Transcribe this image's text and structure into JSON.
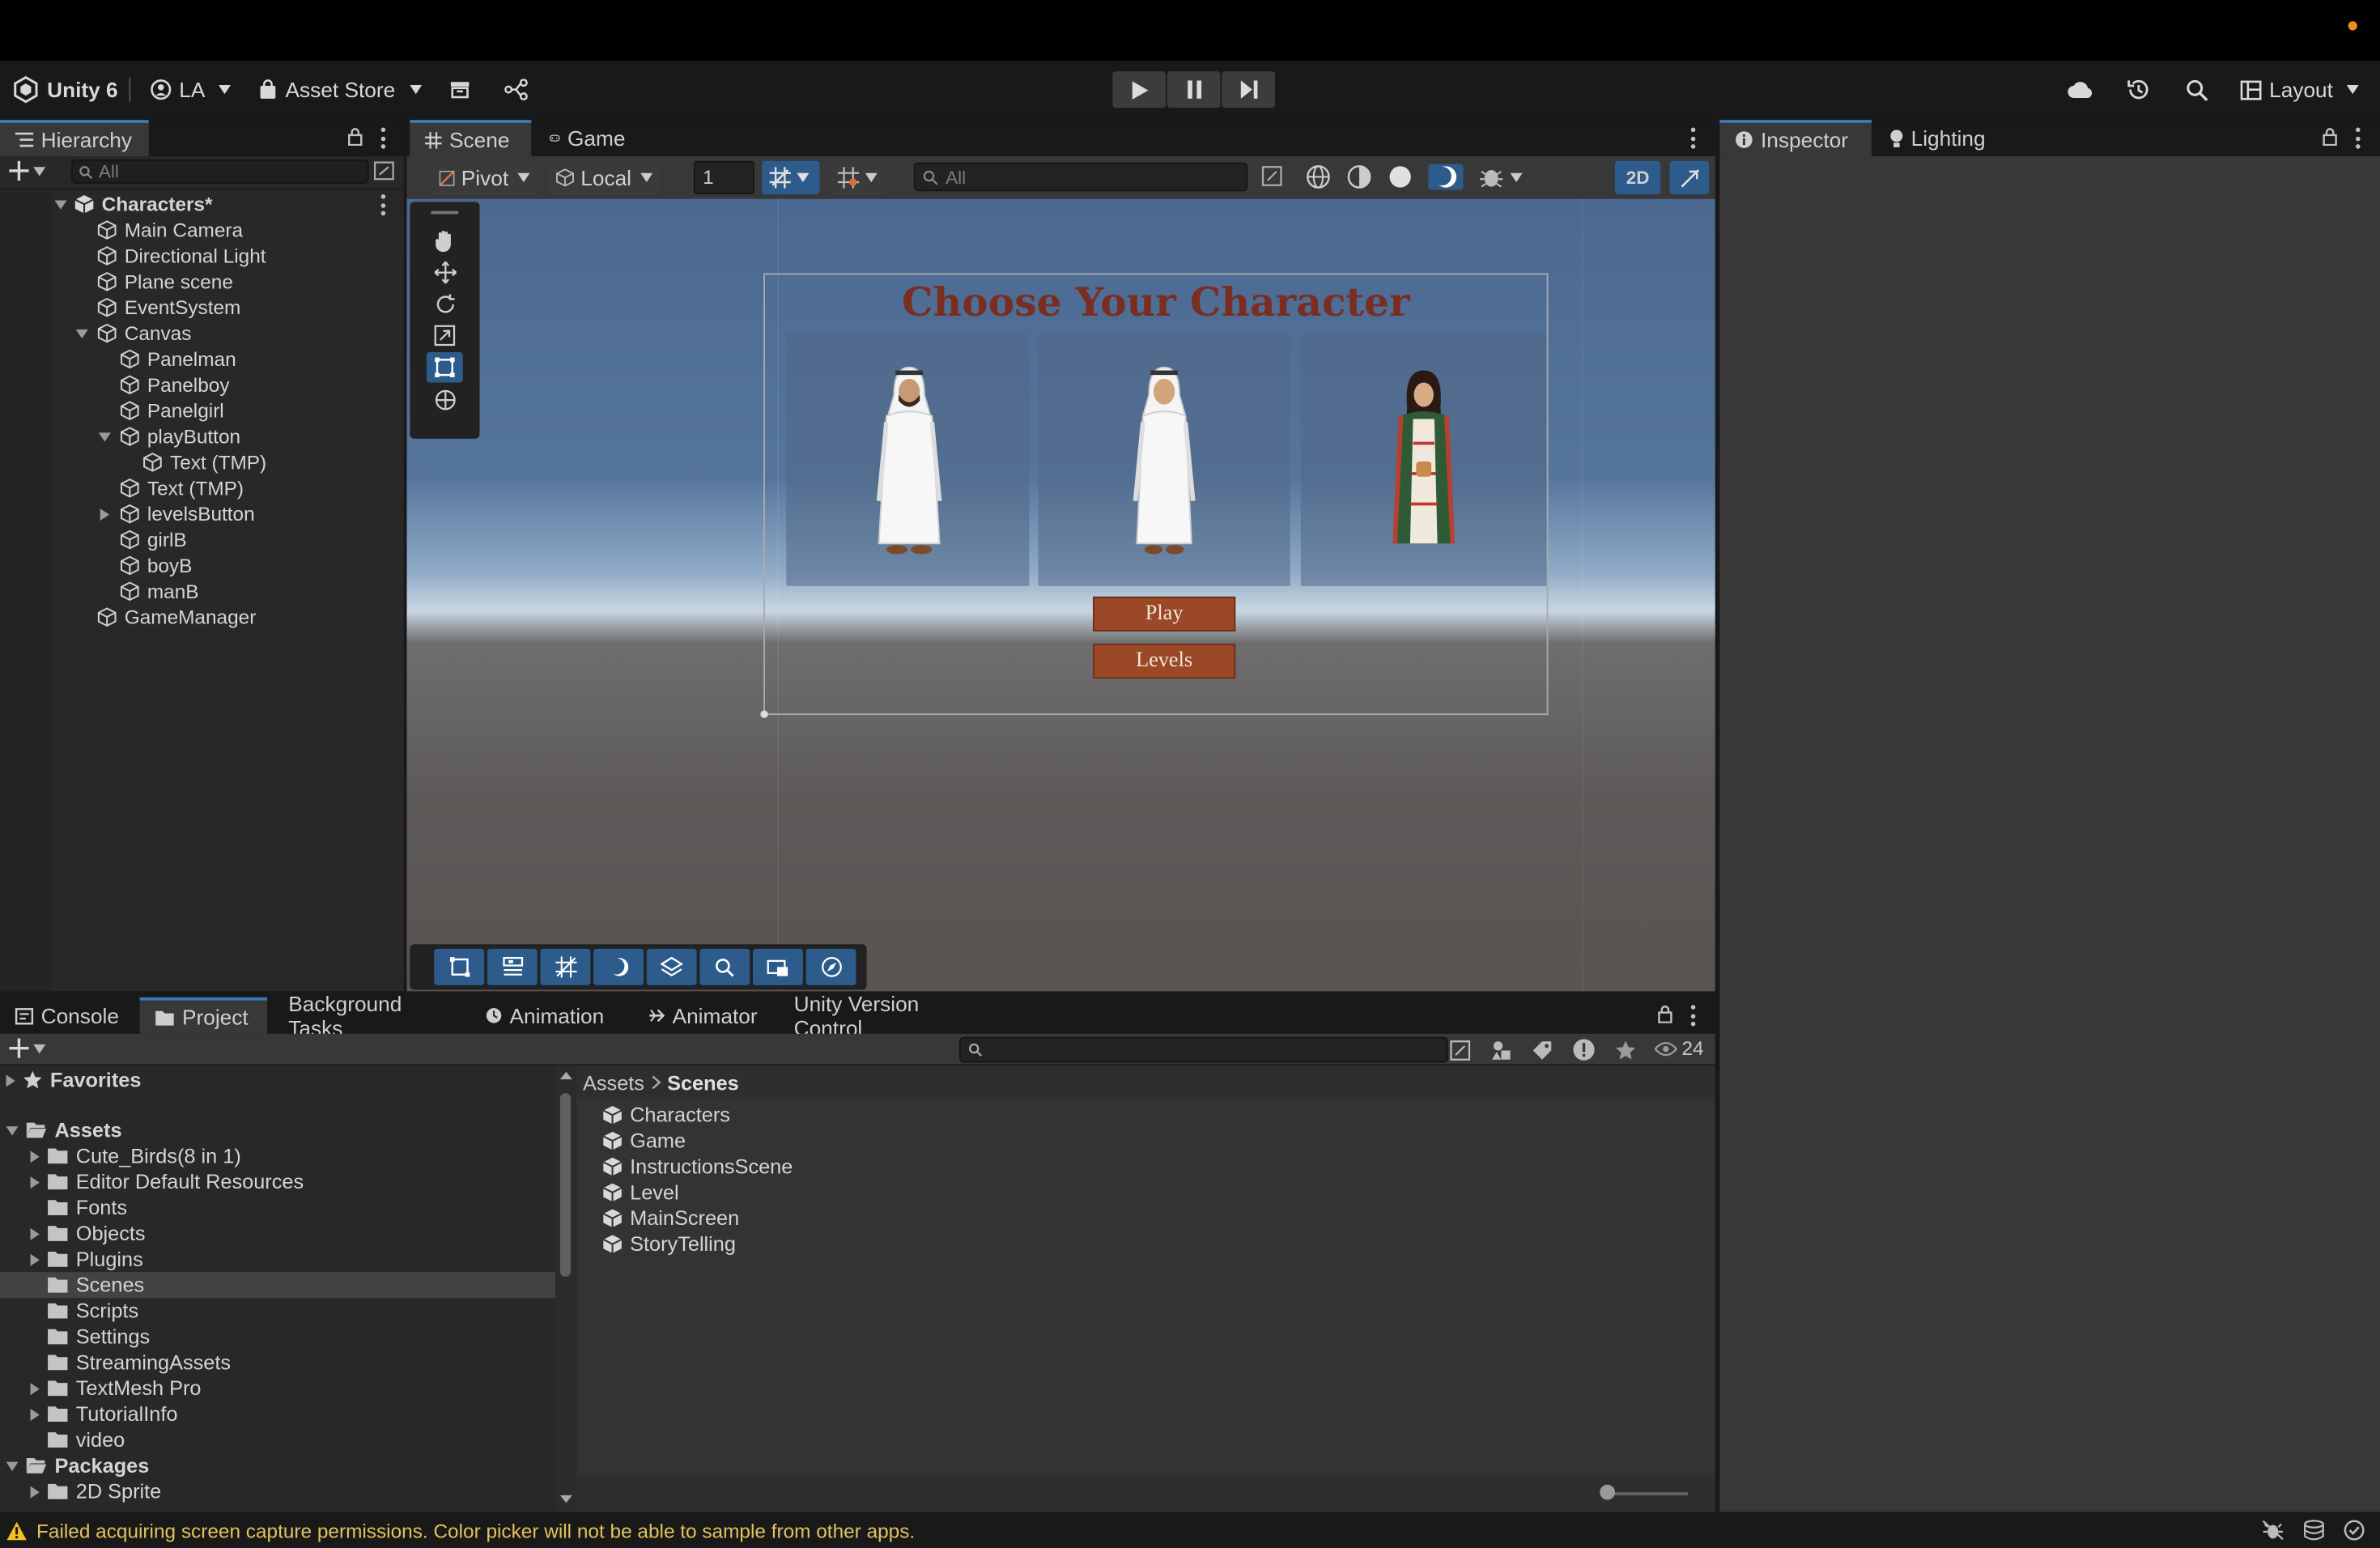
{
  "app": {
    "title": "Unity 6"
  },
  "toolbar": {
    "account": "LA",
    "asset_store": "Asset Store",
    "layout": "Layout"
  },
  "hierarchy": {
    "tab": "Hierarchy",
    "search_placeholder": "All",
    "root": "Characters*",
    "items": [
      "Main Camera",
      "Directional Light",
      "Plane scene",
      "EventSystem",
      "Canvas",
      "Panelman",
      "Panelboy",
      "Panelgirl",
      "playButton",
      "Text (TMP)",
      "Text (TMP)",
      "levelsButton",
      "girlB",
      "boyB",
      "manB",
      "GameManager"
    ]
  },
  "scene": {
    "tabs": [
      "Scene",
      "Game"
    ],
    "pivot": "Pivot",
    "local": "Local",
    "grid_size": "1",
    "search_placeholder": "All",
    "mode_2d": "2D",
    "ui": {
      "title": "Choose Your Character",
      "play": "Play",
      "levels": "Levels"
    }
  },
  "inspector": {
    "tabs": [
      "Inspector",
      "Lighting"
    ]
  },
  "bottom": {
    "tabs": [
      "Console",
      "Project",
      "Background Tasks",
      "Animation",
      "Animator",
      "Unity Version Control"
    ],
    "visible_count": "24",
    "breadcrumb": [
      "Assets",
      "Scenes"
    ],
    "tree": {
      "favorites": "Favorites",
      "assets": "Assets",
      "folders": [
        "Cute_Birds(8 in 1)",
        "Editor Default Resources",
        "Fonts",
        "Objects",
        "Plugins",
        "Scenes",
        "Scripts",
        "Settings",
        "StreamingAssets",
        "TextMesh Pro",
        "TutorialInfo",
        "video"
      ],
      "packages": "Packages",
      "packages_first": "2D Sprite"
    },
    "scenes": [
      "Characters",
      "Game",
      "InstructionsScene",
      "Level",
      "MainScreen",
      "StoryTelling"
    ]
  },
  "status": {
    "message": "Failed acquiring screen capture permissions. Color picker will not be able to sample from other apps."
  },
  "colors": {
    "accent": "#2d5b8c",
    "button": "#9a4826",
    "title_text": "#7a2e22",
    "warning": "#f0c020"
  }
}
